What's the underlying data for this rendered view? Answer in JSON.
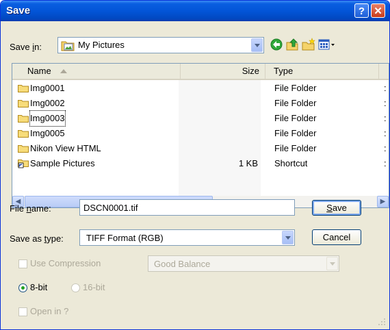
{
  "window": {
    "title": "Save",
    "help_glyph": "?",
    "close_glyph": "✕"
  },
  "save_in": {
    "label_pre": "Save ",
    "label_key": "i",
    "label_post": "n:",
    "value": "My Pictures"
  },
  "list": {
    "headers": {
      "name": "Name",
      "size": "Size",
      "type": "Type"
    },
    "rows": [
      {
        "name": "Img0001",
        "size": "",
        "type": "File Folder",
        "icon": "folder-icon"
      },
      {
        "name": "Img0002",
        "size": "",
        "type": "File Folder",
        "icon": "folder-icon"
      },
      {
        "name": "Img0003",
        "size": "",
        "type": "File Folder",
        "icon": "folder-icon"
      },
      {
        "name": "Img0005",
        "size": "",
        "type": "File Folder",
        "icon": "folder-icon"
      },
      {
        "name": "Nikon View HTML",
        "size": "",
        "type": "File Folder",
        "icon": "folder-icon"
      },
      {
        "name": "Sample Pictures",
        "size": "1 KB",
        "type": "Shortcut",
        "icon": "shortcut-folder-icon"
      }
    ],
    "scroll_left": "◀",
    "scroll_right": "▶"
  },
  "file_name": {
    "label_pre": "File ",
    "label_key": "n",
    "label_post": "ame:",
    "value": "DSCN0001.tif"
  },
  "save_as_type": {
    "label_pre": "Save as ",
    "label_key": "t",
    "label_post": "ype:",
    "value": "TIFF Format (RGB)"
  },
  "buttons": {
    "save_key": "S",
    "save_rest": "ave",
    "cancel": "Cancel"
  },
  "options": {
    "use_compression": "Use Compression",
    "compression_value": "Good Balance",
    "bit8": "8-bit",
    "bit16": "16-bit",
    "open_in": "Open in ?"
  },
  "colors": {
    "titlebar": "#0355d8",
    "face": "#ece9d8",
    "border": "#7f9db9"
  }
}
